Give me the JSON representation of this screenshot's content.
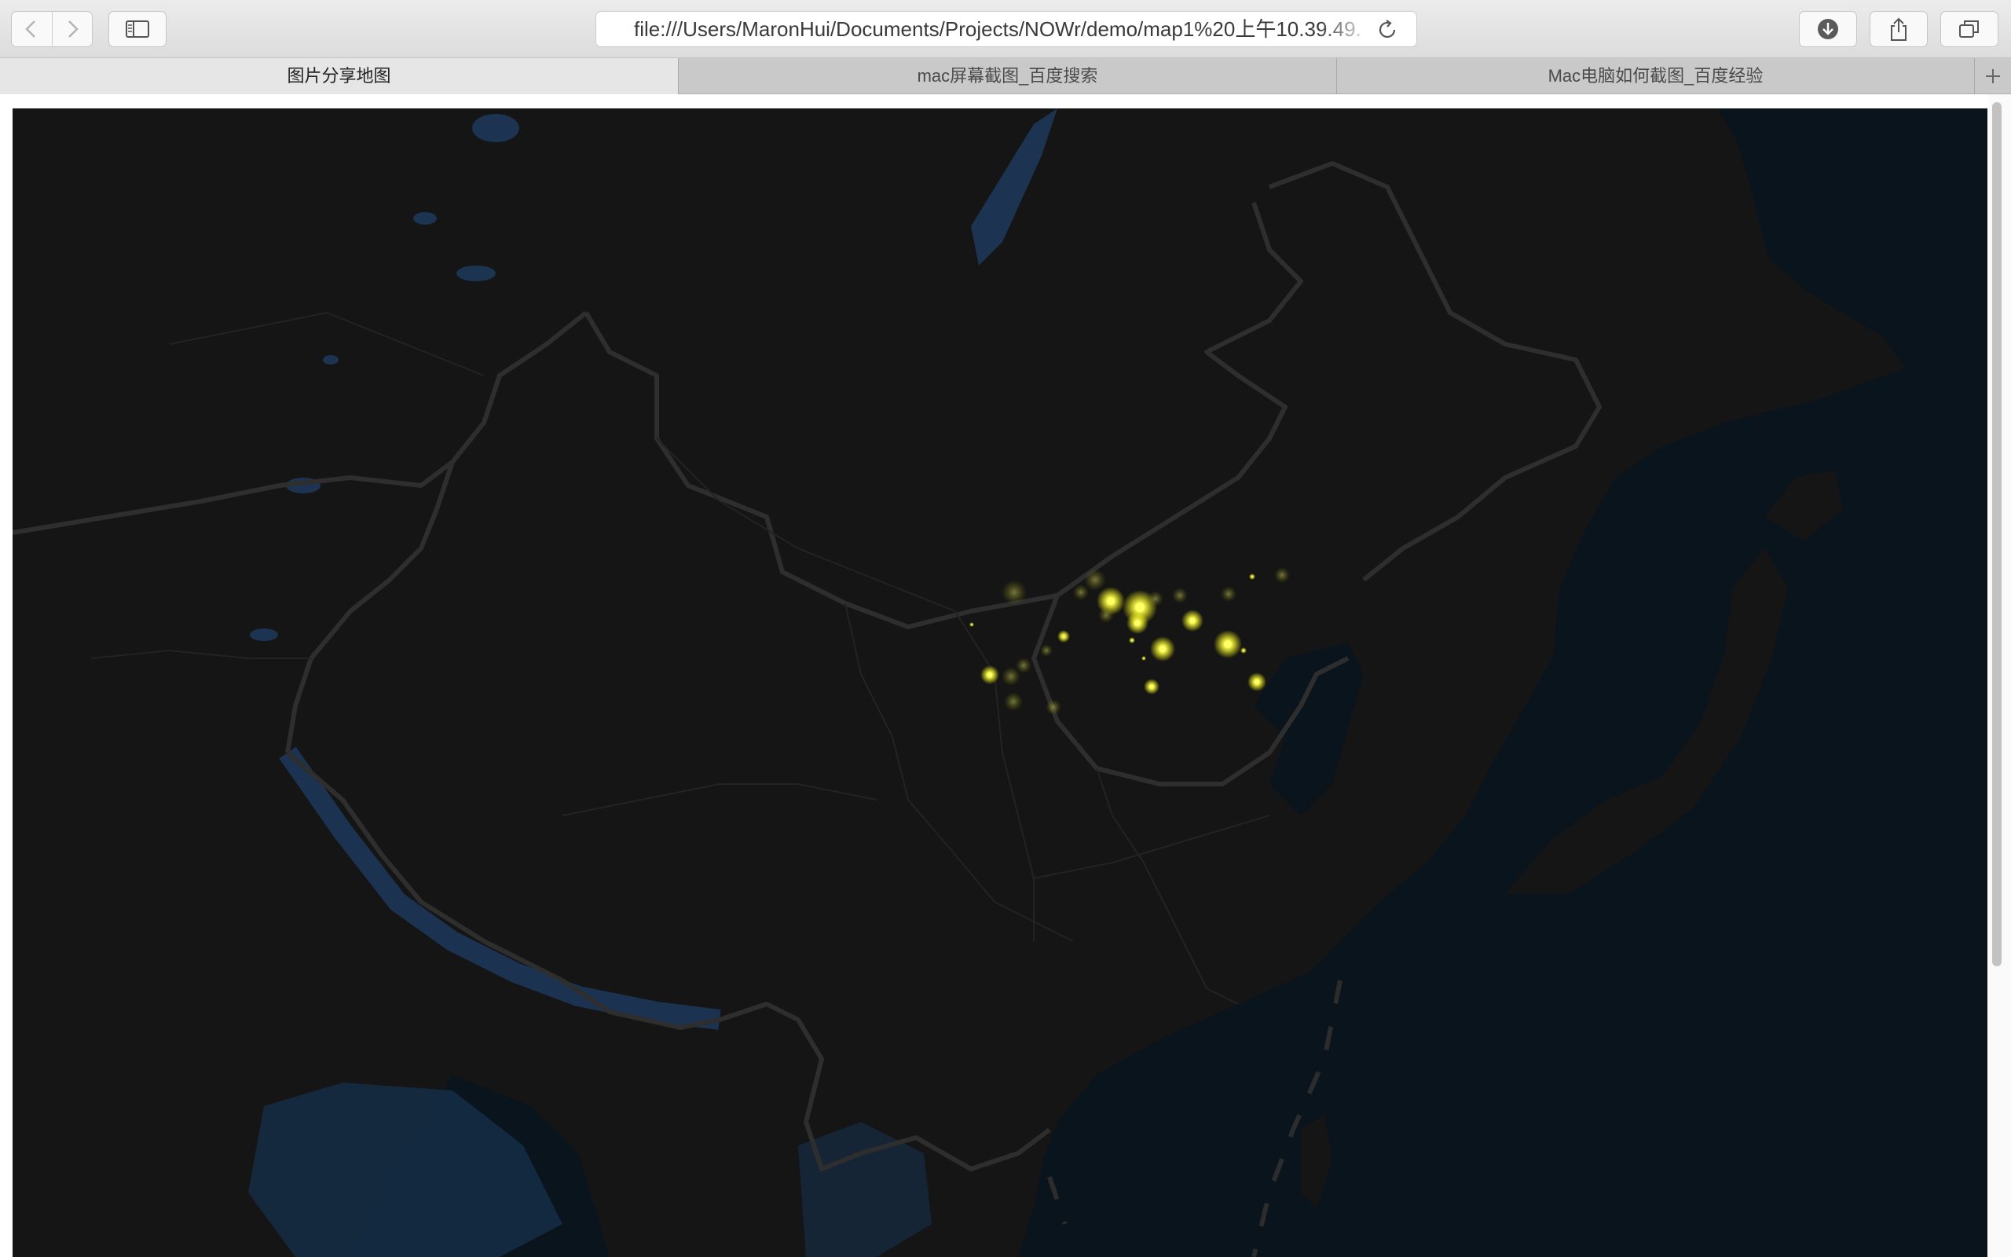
{
  "browser": {
    "address": "file:///Users/MaronHui/Documents/Projects/NOWr/demo/map1%20上午10.39.49.",
    "tabs": [
      {
        "label": "图片分享地图",
        "active": true
      },
      {
        "label": "mac屏幕截图_百度搜索",
        "active": false
      },
      {
        "label": "Mac电脑如何截图_百度经验",
        "active": false
      }
    ],
    "toolbar_icons": [
      "back-icon",
      "forward-icon",
      "sidebar-icon",
      "reload-icon",
      "download-icon",
      "share-icon",
      "tabs-overview-icon",
      "new-tab-icon"
    ]
  },
  "map": {
    "theme": "dark",
    "colors": {
      "ocean": "#0a141d",
      "land": "#151515",
      "border": "#2e2e2e",
      "water": "#1d3a5c",
      "point": "#ffff66"
    },
    "point_count": 28
  }
}
